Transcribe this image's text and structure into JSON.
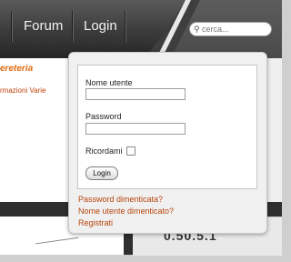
{
  "nav": {
    "forum_label": "Forum",
    "login_label": "Login"
  },
  "search": {
    "placeholder": "cerca...",
    "icon": "search-icon"
  },
  "content": {
    "title_partial": "ereteria",
    "link_partial": "rmazioni Varie"
  },
  "login": {
    "username_label": "Nome utente",
    "username_value": "",
    "password_label": "Password",
    "password_value": "",
    "remember_label": "Ricordami",
    "remember_checked": false,
    "submit_label": "Login"
  },
  "links": {
    "forgot_password": "Password dimenticata?",
    "forgot_username": "Nome utente dimenticato?",
    "register": "Registrati"
  },
  "bottom": {
    "counter_text": "0.50.5.1"
  },
  "colors": {
    "accent": "#e06a10",
    "link": "#b8450c",
    "navbar": "#3b3b3b"
  }
}
